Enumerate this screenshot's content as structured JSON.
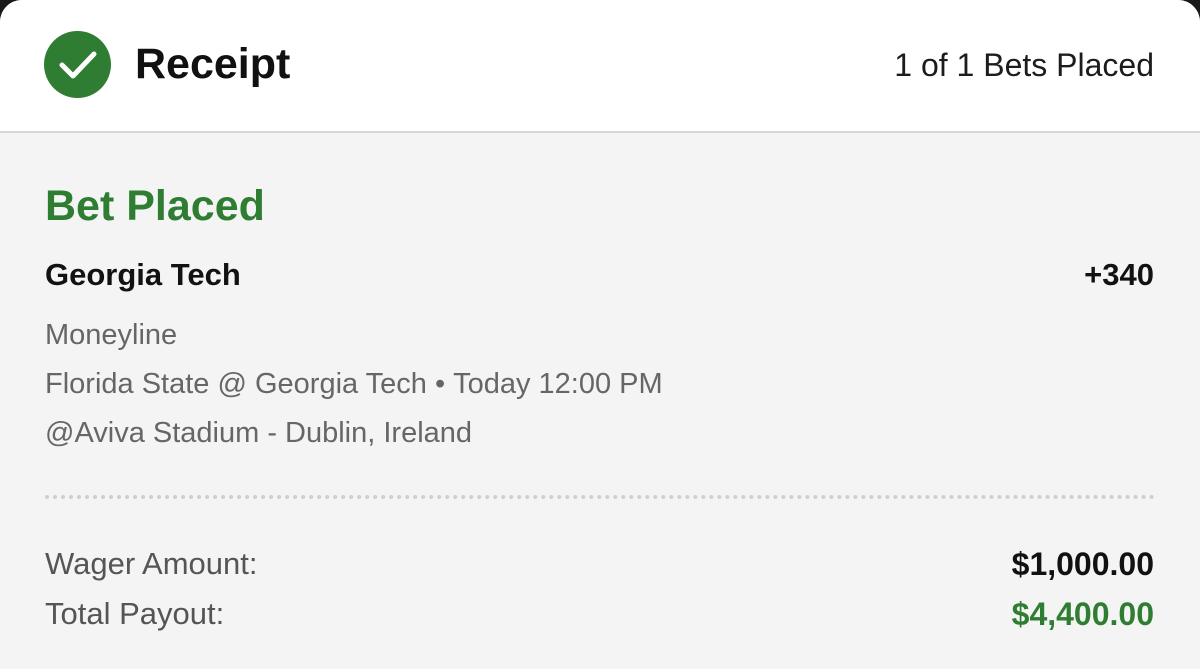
{
  "header": {
    "title": "Receipt",
    "bets_count": "1 of 1 Bets Placed"
  },
  "bet": {
    "status": "Bet Placed",
    "selection": "Georgia Tech",
    "odds": "+340",
    "bet_type": "Moneyline",
    "matchup": "Florida State @ Georgia Tech",
    "separator": "•",
    "time": "Today 12:00 PM",
    "venue": "@Aviva Stadium - Dublin, Ireland"
  },
  "summary": {
    "wager_label": "Wager Amount:",
    "wager_value": "$1,000.00",
    "payout_label": "Total Payout:",
    "payout_value": "$4,400.00"
  },
  "colors": {
    "accent_green": "#2e7d32",
    "text_primary": "#111111",
    "text_secondary": "#666666"
  },
  "icons": {
    "status": "check-circle-icon"
  }
}
